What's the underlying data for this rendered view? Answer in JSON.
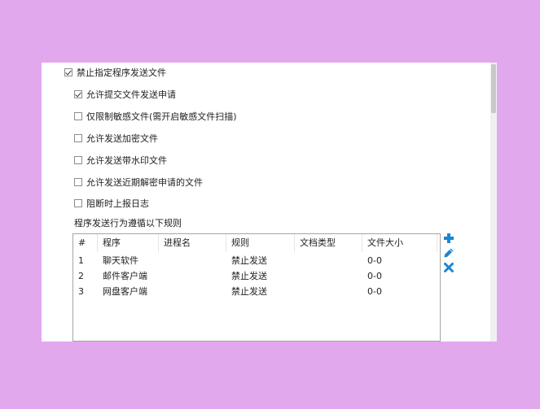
{
  "options": {
    "block_program_send": {
      "label": "禁止指定程序发送文件",
      "checked": true
    },
    "allow_submit_request": {
      "label": "允许提交文件发送申请",
      "checked": true
    },
    "restrict_sensitive_only": {
      "label": "仅限制敏感文件(需开启敏感文件扫描)",
      "checked": false
    },
    "allow_encrypted": {
      "label": "允许发送加密文件",
      "checked": false
    },
    "allow_watermarked": {
      "label": "允许发送带水印文件",
      "checked": false
    },
    "allow_recent_decrypt": {
      "label": "允许发送近期解密申请的文件",
      "checked": false
    },
    "report_log_on_block": {
      "label": "阻断时上报日志",
      "checked": false
    }
  },
  "rules_label": "程序发送行为遵循以下规则",
  "table": {
    "columns": [
      "#",
      "程序",
      "进程名",
      "规则",
      "文档类型",
      "文件大小"
    ],
    "rows": [
      [
        "1",
        "聊天软件",
        "",
        "禁止发送",
        "",
        "0-0"
      ],
      [
        "2",
        "邮件客户端",
        "",
        "禁止发送",
        "",
        "0-0"
      ],
      [
        "3",
        "网盘客户端",
        "",
        "禁止发送",
        "",
        "0-0"
      ]
    ]
  },
  "actions": {
    "add_icon": "plus-icon",
    "edit_icon": "pencil-icon",
    "delete_icon": "close-icon",
    "accent_color": "#1a86d0"
  }
}
